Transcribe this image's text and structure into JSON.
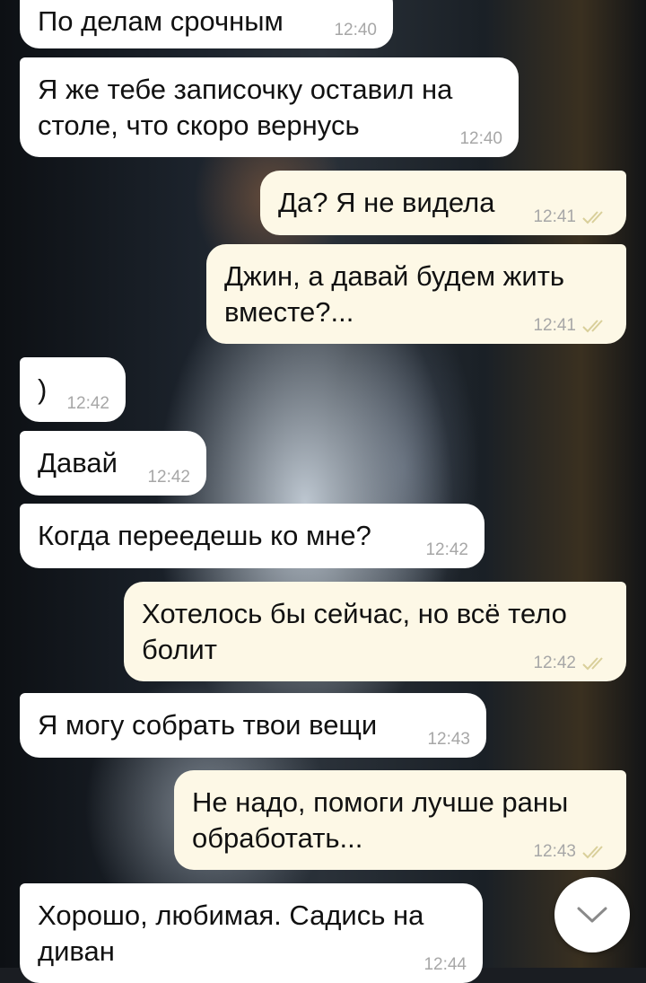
{
  "messages": [
    {
      "text": "По делам срочным",
      "time": "12:40",
      "direction": "incoming"
    },
    {
      "text": "Я же тебе записочку оставил на\nстоле, что скоро вернусь",
      "time": "12:40",
      "direction": "incoming"
    },
    {
      "text": "Да? Я не видела",
      "time": "12:41",
      "direction": "outgoing",
      "status": "read"
    },
    {
      "text": "Джин, а давай будем жить\nвместе?...",
      "time": "12:41",
      "direction": "outgoing",
      "status": "read"
    },
    {
      "text": ")",
      "time": "12:42",
      "direction": "incoming"
    },
    {
      "text": "Давай",
      "time": "12:42",
      "direction": "incoming"
    },
    {
      "text": "Когда переедешь ко мне?",
      "time": "12:42",
      "direction": "incoming"
    },
    {
      "text": "Хотелось бы сейчас, но всё тело\nболит",
      "time": "12:42",
      "direction": "outgoing",
      "status": "read"
    },
    {
      "text": "Я могу собрать твои вещи",
      "time": "12:43",
      "direction": "incoming"
    },
    {
      "text": "Не надо, помоги лучше раны\nобработать...",
      "time": "12:43",
      "direction": "outgoing",
      "status": "read"
    },
    {
      "text": "Хорошо, любимая. Садись на\nдиван",
      "time": "12:44",
      "direction": "incoming"
    }
  ],
  "colors": {
    "incoming_bubble": "#ffffff",
    "outgoing_bubble": "#fdf8e6",
    "read_ticks": "#d9cf9a",
    "timestamp": "#a7a7a7"
  },
  "scroll_down_button": {
    "icon": "chevron-down-icon"
  }
}
